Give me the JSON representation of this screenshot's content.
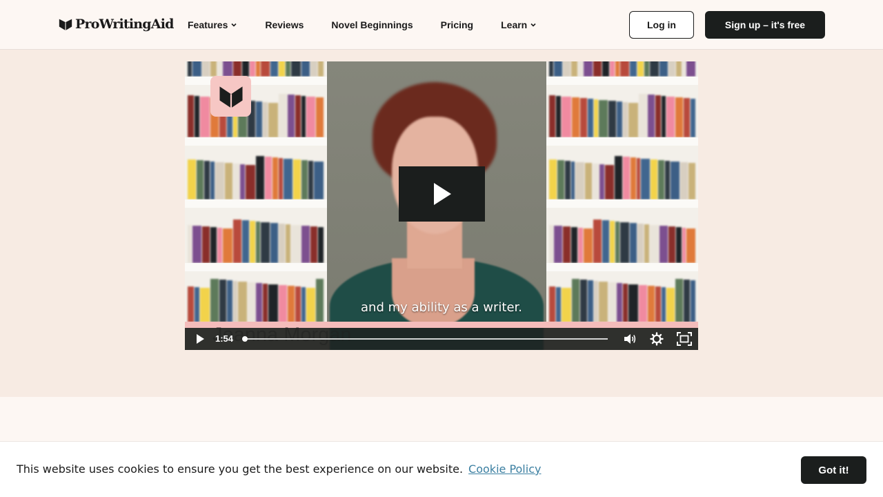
{
  "header": {
    "logo_text": "ProWritingAid",
    "nav": [
      {
        "label": "Features",
        "has_dropdown": true
      },
      {
        "label": "Reviews",
        "has_dropdown": false
      },
      {
        "label": "Novel Beginnings",
        "has_dropdown": false
      },
      {
        "label": "Pricing",
        "has_dropdown": false
      },
      {
        "label": "Learn",
        "has_dropdown": true
      }
    ],
    "login_label": "Log in",
    "signup_label": "Sign up – it's free"
  },
  "video": {
    "subtitle": "and my ability as a writer.",
    "time": "1:54",
    "behind_text": "Joanna Morgan",
    "progress_fraction": 0.0,
    "icons": [
      "play-icon",
      "volume-icon",
      "settings-icon",
      "fullscreen-icon"
    ]
  },
  "cookie": {
    "message": "This website uses cookies to ensure you get the best experience on our website.",
    "link_label": "Cookie Policy",
    "button_label": "Got it!"
  },
  "colors": {
    "background": "#fdf7f3",
    "hero": "#f7ebe3",
    "dark_button": "#1b1e1d",
    "badge_pink": "#f6c7c4",
    "link_blue": "#3b7fa1"
  }
}
